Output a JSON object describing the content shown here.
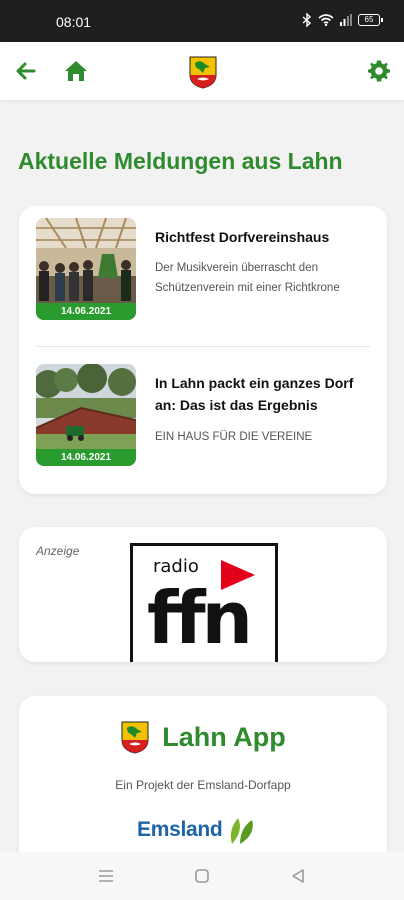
{
  "status_bar": {
    "time": "08:01",
    "battery": "65"
  },
  "top_bar": {
    "back_icon": "arrow-left-icon",
    "home_icon": "home-icon",
    "logo": "lahn-crest",
    "settings_icon": "gear-icon",
    "accent_color": "#2e8b2e"
  },
  "main": {
    "title": "Aktuelle Meldungen aus Lahn",
    "news": [
      {
        "title": "Richtfest Dorfvereinshaus",
        "subtitle": "Der Musikverein überrascht den Schützenverein mit einer Richtkrone",
        "date": "14.06.2021"
      },
      {
        "title": "In Lahn packt ein ganzes Dorf an: Das ist das Ergebnis",
        "subtitle": "EIN HAUS FÜR DIE VEREINE",
        "date": "14.06.2021"
      }
    ],
    "ad": {
      "label": "Anzeige",
      "logo_text_top": "radio",
      "logo_text_main": "ffn"
    },
    "app_info": {
      "name": "Lahn App",
      "subtitle": "Ein Projekt der Emsland-Dorfapp",
      "partner": "Emsland"
    }
  },
  "nav_bar": {
    "menu_icon": "menu-icon",
    "home_icon": "square-icon",
    "back_icon": "triangle-back-icon"
  }
}
